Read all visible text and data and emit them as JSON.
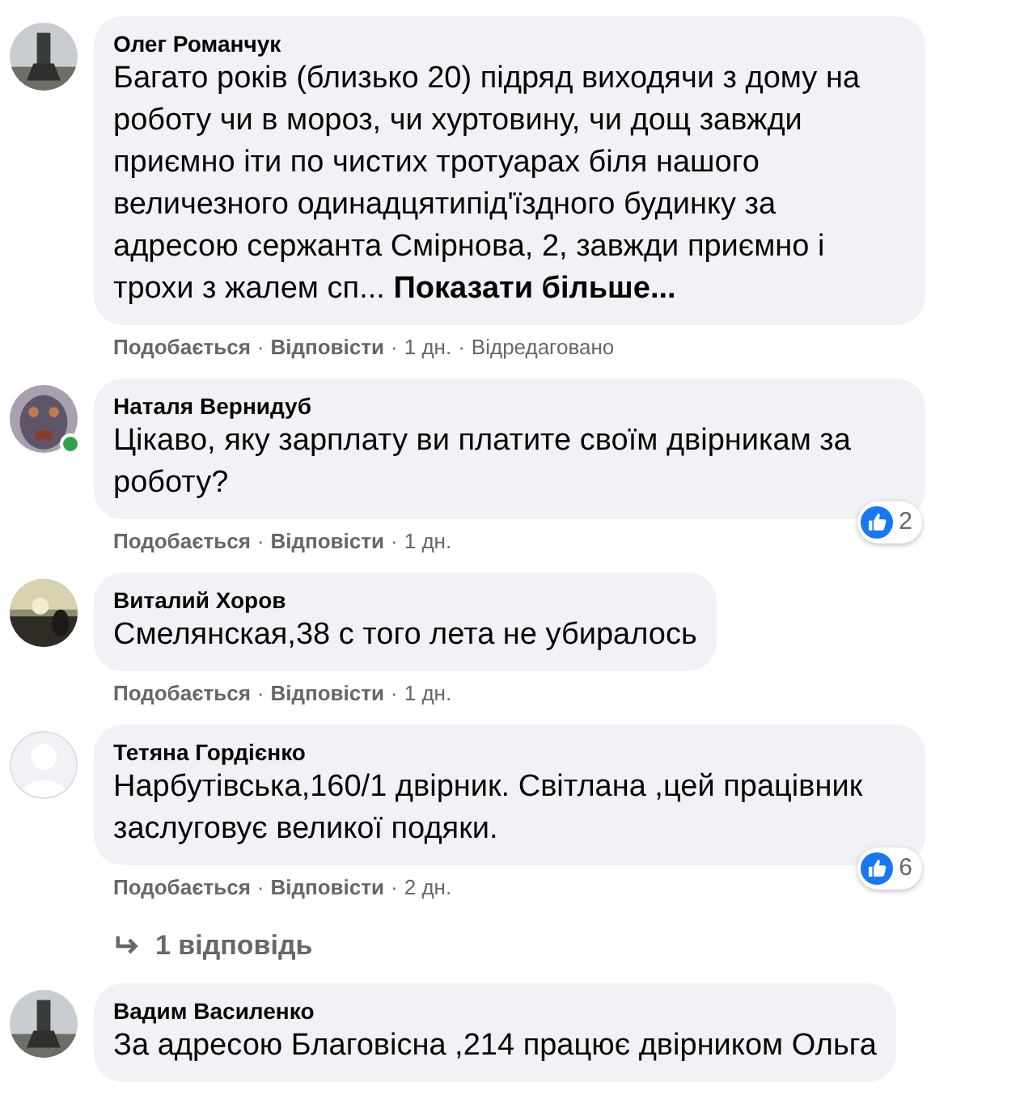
{
  "comments": [
    {
      "author": "Олег Романчук",
      "online": false,
      "text": "Багато років (близько 20) підряд виходячи з дому на роботу чи в мороз, чи хуртовину, чи дощ завжди приємно іти по чистих тротуарах біля нашого величезного одинадцятипід'їздного будинку за адресою сержанта Смірнова, 2, завжди приємно і трохи з жалем сп...",
      "more_link": "Показати більше...",
      "actions": [
        {
          "kind": "link",
          "text": "Подобається"
        },
        {
          "kind": "dot",
          "text": "·"
        },
        {
          "kind": "link",
          "text": "Відповісти"
        },
        {
          "kind": "dot",
          "text": "·"
        },
        {
          "kind": "meta",
          "text": "1 дн."
        },
        {
          "kind": "dot",
          "text": "·"
        },
        {
          "kind": "meta",
          "text": "Відредаговано"
        }
      ]
    },
    {
      "author": "Наталя Вернидуб",
      "online": true,
      "text": "Цікаво, яку зарплату ви платите своїм двірникам за роботу?",
      "reactions": {
        "count": "2"
      },
      "actions": [
        {
          "kind": "link",
          "text": "Подобається"
        },
        {
          "kind": "dot",
          "text": "·"
        },
        {
          "kind": "link",
          "text": "Відповісти"
        },
        {
          "kind": "dot",
          "text": "·"
        },
        {
          "kind": "meta",
          "text": "1 дн."
        }
      ]
    },
    {
      "author": "Виталий Хоров",
      "online": false,
      "text": "Смелянская,38 с того лета не убиралось",
      "actions": [
        {
          "kind": "link",
          "text": "Подобається"
        },
        {
          "kind": "dot",
          "text": "·"
        },
        {
          "kind": "link",
          "text": "Відповісти"
        },
        {
          "kind": "dot",
          "text": "·"
        },
        {
          "kind": "meta",
          "text": "1 дн."
        }
      ]
    },
    {
      "author": "Тетяна Гордієнко",
      "avatar": {
        "kind": "default"
      },
      "online": false,
      "text": "Нарбутівська,160/1 двірник. Світлана ,цей працівник заслуговує великої подяки.",
      "reactions": {
        "count": "6"
      },
      "actions": [
        {
          "kind": "link",
          "text": "Подобається"
        },
        {
          "kind": "dot",
          "text": "·"
        },
        {
          "kind": "link",
          "text": "Відповісти"
        },
        {
          "kind": "dot",
          "text": "·"
        },
        {
          "kind": "meta",
          "text": "2 дн."
        }
      ],
      "replies_link": "1 відповідь"
    },
    {
      "author": "Вадим Василенко",
      "online": false,
      "text": "За адресою Благовісна ,214 працює двірником Ольга"
    }
  ]
}
